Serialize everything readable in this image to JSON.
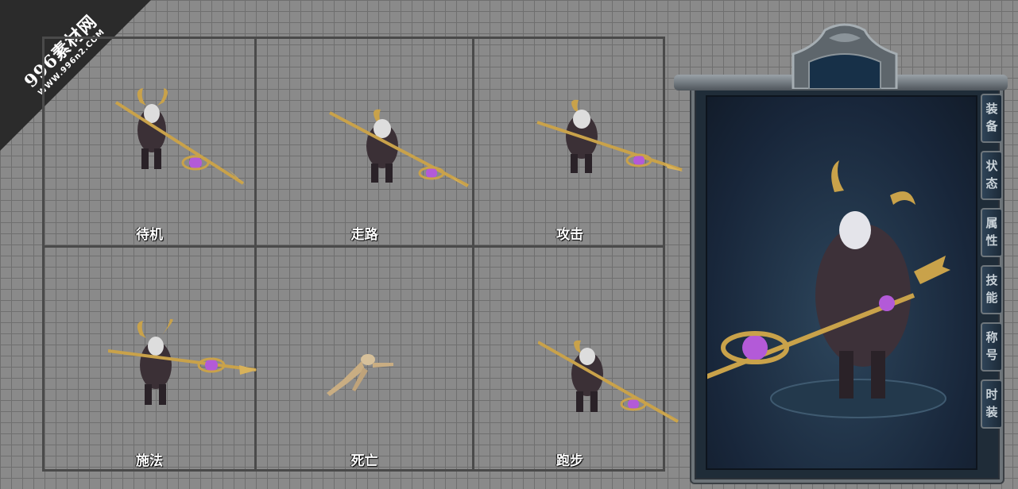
{
  "watermark": {
    "title": "996素材网",
    "url": "WWW.996n2.COM"
  },
  "animations": [
    {
      "label": "待机"
    },
    {
      "label": "走路"
    },
    {
      "label": "攻击"
    },
    {
      "label": "施法"
    },
    {
      "label": "死亡"
    },
    {
      "label": "跑步"
    }
  ],
  "panel": {
    "tabs": [
      {
        "top": "装",
        "bottom": "备"
      },
      {
        "top": "状",
        "bottom": "态"
      },
      {
        "top": "属",
        "bottom": "性"
      },
      {
        "top": "技",
        "bottom": "能"
      },
      {
        "top": "称",
        "bottom": "号"
      },
      {
        "top": "时",
        "bottom": "装"
      }
    ]
  },
  "colors": {
    "gold": "#c9a24a",
    "purple": "#b35ad8",
    "panel_bg": "#1f2c38",
    "frame": "#6d7479"
  }
}
